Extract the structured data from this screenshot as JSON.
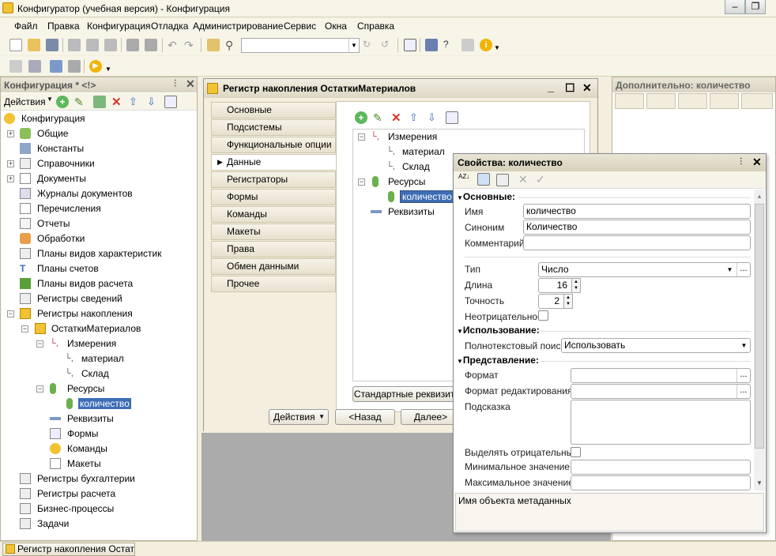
{
  "window": {
    "title": "Конфигуратор (учебная версия) - Конфигурация"
  },
  "menu": [
    "Файл",
    "Правка",
    "Конфигурация",
    "Отладка",
    "Администрирование",
    "Сервис",
    "Окна",
    "Справка"
  ],
  "left_panel": {
    "title": "Конфигурация * <!>",
    "actions_label": "Действия",
    "tree": [
      {
        "label": "Конфигурация",
        "icon": "config-icon"
      },
      {
        "label": "Общие",
        "icon": "common-icon"
      },
      {
        "label": "Константы",
        "icon": "constants-icon"
      },
      {
        "label": "Справочники",
        "icon": "catalogs-icon"
      },
      {
        "label": "Документы",
        "icon": "documents-icon"
      },
      {
        "label": "Журналы документов",
        "icon": "journals-icon"
      },
      {
        "label": "Перечисления",
        "icon": "enums-icon"
      },
      {
        "label": "Отчеты",
        "icon": "reports-icon"
      },
      {
        "label": "Обработки",
        "icon": "processing-icon"
      },
      {
        "label": "Планы видов характеристик",
        "icon": "chart-of-characteristics-icon"
      },
      {
        "label": "Планы счетов",
        "icon": "chart-of-accounts-icon"
      },
      {
        "label": "Планы видов расчета",
        "icon": "calc-types-icon"
      },
      {
        "label": "Регистры сведений",
        "icon": "info-registers-icon"
      },
      {
        "label": "Регистры накопления",
        "icon": "accum-registers-icon"
      },
      {
        "label": "ОстаткиМатериалов",
        "icon": "register-icon"
      },
      {
        "label": "Измерения",
        "icon": "dimensions-icon"
      },
      {
        "label": "материал",
        "icon": "dimension-icon"
      },
      {
        "label": "Склад",
        "icon": "dimension-icon"
      },
      {
        "label": "Ресурсы",
        "icon": "resources-icon"
      },
      {
        "label": "количество",
        "icon": "resource-icon"
      },
      {
        "label": "Реквизиты",
        "icon": "attributes-icon"
      },
      {
        "label": "Формы",
        "icon": "forms-icon"
      },
      {
        "label": "Команды",
        "icon": "commands-icon"
      },
      {
        "label": "Макеты",
        "icon": "templates-icon"
      },
      {
        "label": "Регистры бухгалтерии",
        "icon": "accounting-registers-icon"
      },
      {
        "label": "Регистры расчета",
        "icon": "calc-registers-icon"
      },
      {
        "label": "Бизнес-процессы",
        "icon": "business-processes-icon"
      },
      {
        "label": "Задачи",
        "icon": "tasks-icon"
      }
    ]
  },
  "register_window": {
    "title": "Регистр накопления ОстаткиМатериалов",
    "tabs": [
      "Основные",
      "Подсистемы",
      "Функциональные опции",
      "Данные",
      "Регистраторы",
      "Формы",
      "Команды",
      "Макеты",
      "Права",
      "Обмен данными",
      "Прочее"
    ],
    "active_tab": "Данные",
    "data_tree": [
      "Измерения",
      "материал",
      "Склад",
      "Ресурсы",
      "количество",
      "Реквизиты"
    ],
    "std_attrs_button": "Стандартные реквизиты",
    "actions_button": "Действия",
    "back_button": "<Назад",
    "next_button": "Далее>"
  },
  "right_panel": {
    "title": "Дополнительно: количество"
  },
  "properties": {
    "title": "Свойства: количество",
    "sections": {
      "main": "Основные:",
      "usage": "Использование:",
      "presentation": "Представление:"
    },
    "fields": {
      "name_label": "Имя",
      "name_value": "количество",
      "synonym_label": "Синоним",
      "synonym_value": "Количество",
      "comment_label": "Комментарий",
      "comment_value": "",
      "type_label": "Тип",
      "type_value": "Число",
      "length_label": "Длина",
      "length_value": "16",
      "precision_label": "Точность",
      "precision_value": "2",
      "nonneg_label": "Неотрицательное",
      "fulltext_label": "Полнотекстовый поиск",
      "fulltext_value": "Использовать",
      "format_label": "Формат",
      "editformat_label": "Формат редактирования",
      "hint_label": "Подсказка",
      "highlight_label": "Выделять отрицательные",
      "min_label": "Минимальное значение",
      "max_label": "Максимальное значение"
    },
    "description": "Имя объекта метаданных"
  },
  "statusbar": {
    "task": "Регистр накопления ОстаткиМатериалов"
  },
  "colors": {
    "selection": "#3d6db5",
    "panel_bg": "#f3eedd"
  }
}
